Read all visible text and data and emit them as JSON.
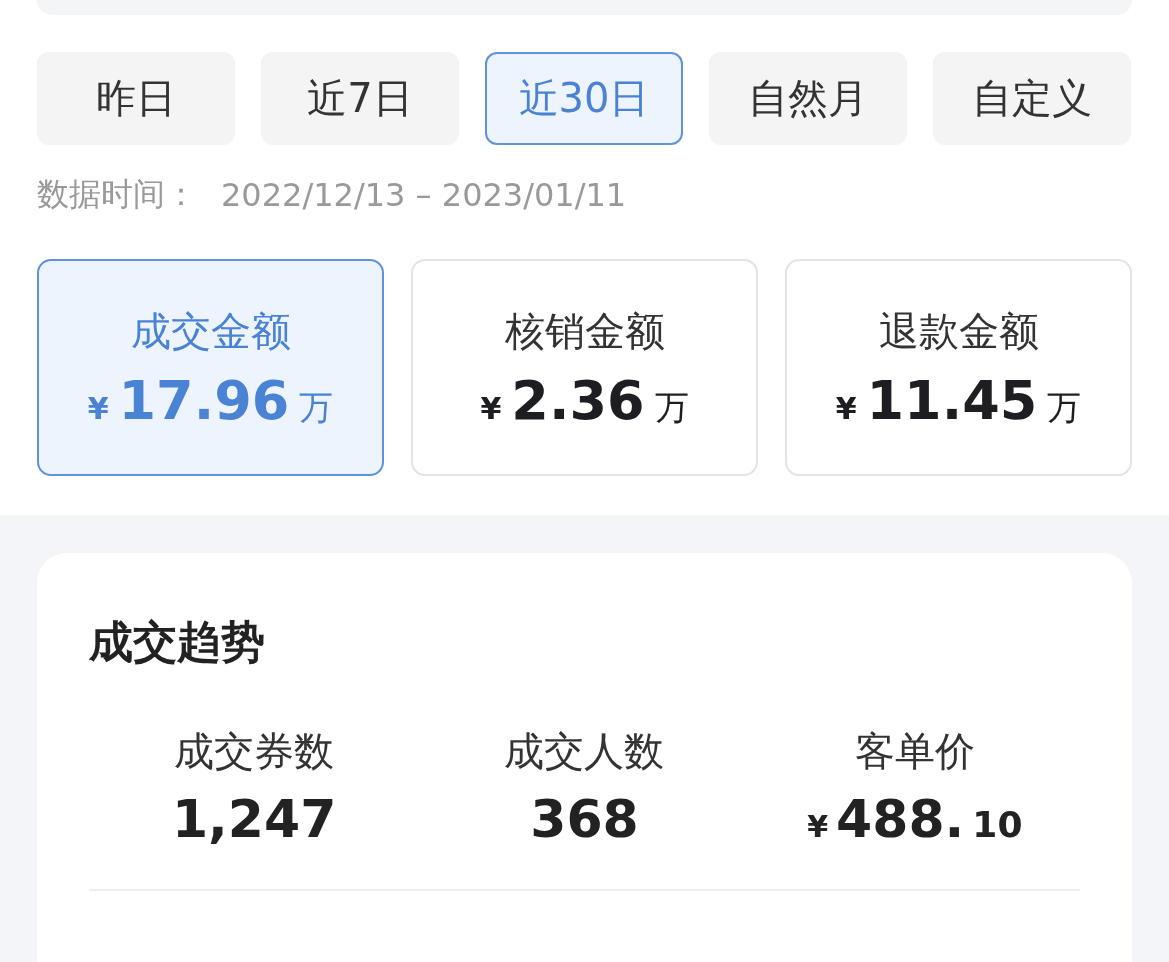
{
  "tabs": [
    {
      "label": "昨日",
      "selected": false
    },
    {
      "label": "近7日",
      "selected": false
    },
    {
      "label": "近30日",
      "selected": true
    },
    {
      "label": "自然月",
      "selected": false
    },
    {
      "label": "自定义",
      "selected": false
    }
  ],
  "data_time": {
    "label": "数据时间：",
    "range": "2022/12/13 – 2023/01/11"
  },
  "metrics": [
    {
      "title": "成交金额",
      "currency": "¥",
      "amount": "17.96",
      "unit": "万",
      "selected": true
    },
    {
      "title": "核销金额",
      "currency": "¥",
      "amount": "2.36",
      "unit": "万",
      "selected": false
    },
    {
      "title": "退款金额",
      "currency": "¥",
      "amount": "11.45",
      "unit": "万",
      "selected": false
    }
  ],
  "trend": {
    "title": "成交趋势",
    "stats": [
      {
        "label": "成交券数",
        "value": "1,247"
      },
      {
        "label": "成交人数",
        "value": "368"
      },
      {
        "label": "客单价",
        "currency": "¥",
        "value": "488.",
        "fraction": "10"
      }
    ]
  }
}
